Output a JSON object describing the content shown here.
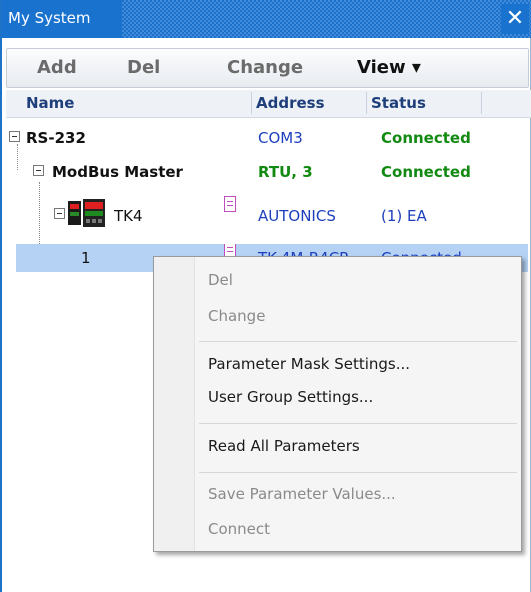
{
  "window": {
    "title": "My System",
    "close_glyph": "✕"
  },
  "toolbar": {
    "add": "Add",
    "del": "Del",
    "change": "Change",
    "view": "View ▾"
  },
  "columns": {
    "name": "Name",
    "address": "Address",
    "status": "Status"
  },
  "tree": {
    "rs232": {
      "name": "RS-232",
      "address": "COM3",
      "status": "Connected"
    },
    "modbus": {
      "name": "ModBus Master",
      "address": "RTU, 3",
      "status": "Connected"
    },
    "tk4": {
      "name": "TK4",
      "address": "AUTONICS",
      "status": "(1) EA"
    },
    "unit1": {
      "name": "1",
      "address": "TK-4M-R4CR",
      "status": "Connected"
    }
  },
  "context_menu": {
    "del": "Del",
    "change": "Change",
    "parameter_mask": "Parameter Mask Settings...",
    "user_group": "User Group Settings...",
    "read_all": "Read All Parameters",
    "save_values": "Save Parameter Values...",
    "connect": "Connect"
  },
  "colors": {
    "titlebar": "#1a72cf",
    "status_green": "#128a12",
    "address_blue": "#1d3fbd",
    "selection": "#b5d2f5"
  }
}
